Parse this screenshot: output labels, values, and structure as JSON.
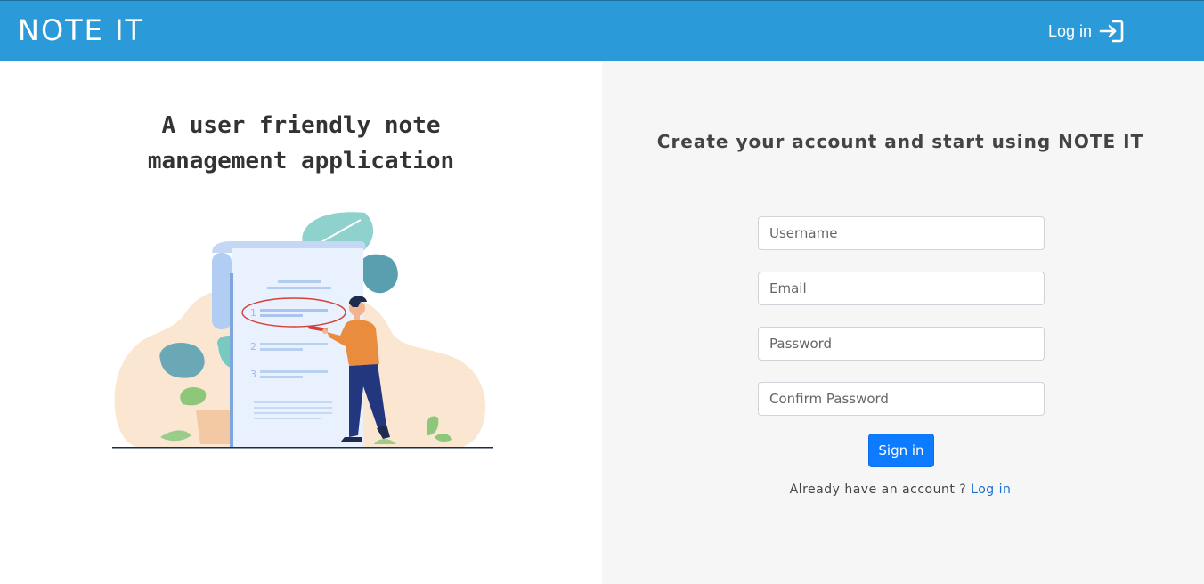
{
  "header": {
    "brand": "NOTE IT",
    "login_label": "Log in",
    "login_icon": "sign-in-icon",
    "bg_color": "#2b9ad9"
  },
  "hero": {
    "tagline_line1": "A user friendly note",
    "tagline_line2": "management application",
    "illustration": "person-writing-checklist-illustration",
    "illustration_list_numbers": [
      "1",
      "2",
      "3"
    ]
  },
  "form": {
    "title": "Create your account and start using NOTE IT",
    "username_placeholder": "Username",
    "email_placeholder": "Email",
    "password_placeholder": "Password",
    "confirm_password_placeholder": "Confirm Password",
    "submit_label": "Sign in",
    "already_text": "Already have an account ?",
    "login_link": "Log in",
    "accent_color": "#0d7bff"
  }
}
